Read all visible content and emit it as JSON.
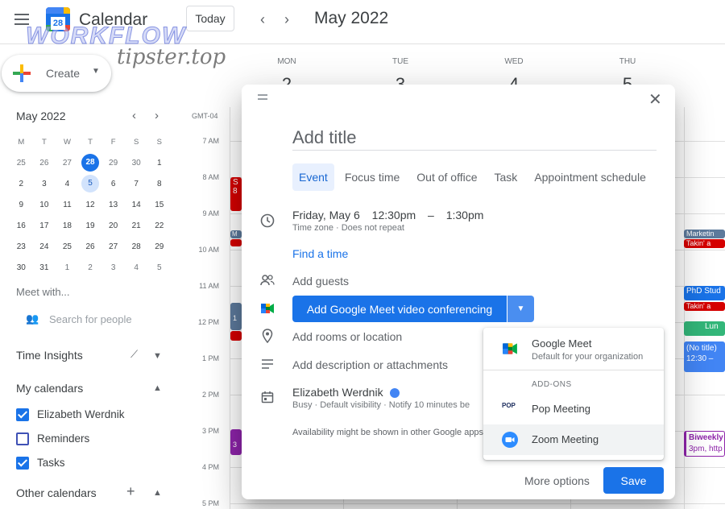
{
  "header": {
    "app_name": "Calendar",
    "logo_day": "28",
    "today_label": "Today",
    "month_title": "May 2022",
    "watermark_top": "WORKFLOW",
    "watermark_bottom": "tipster.top"
  },
  "create": {
    "label": "Create"
  },
  "mini_calendar": {
    "title": "May 2022",
    "weekdays": [
      "M",
      "T",
      "W",
      "T",
      "F",
      "S",
      "S"
    ],
    "weeks": [
      [
        "25",
        "26",
        "27",
        "28",
        "29",
        "30",
        "1"
      ],
      [
        "2",
        "3",
        "4",
        "5",
        "6",
        "7",
        "8"
      ],
      [
        "9",
        "10",
        "11",
        "12",
        "13",
        "14",
        "15"
      ],
      [
        "16",
        "17",
        "18",
        "19",
        "20",
        "21",
        "22"
      ],
      [
        "23",
        "24",
        "25",
        "26",
        "27",
        "28",
        "29"
      ],
      [
        "30",
        "31",
        "1",
        "2",
        "3",
        "4",
        "5"
      ]
    ]
  },
  "sidebar": {
    "meet_with": "Meet with...",
    "search_placeholder": "Search for people",
    "time_insights": "Time Insights",
    "my_calendars": "My calendars",
    "calendars": [
      {
        "name": "Elizabeth Werdnik",
        "checked": true
      },
      {
        "name": "Reminders",
        "checked": false
      },
      {
        "name": "Tasks",
        "checked": true
      }
    ],
    "other_calendars": "Other calendars"
  },
  "week": {
    "days": [
      {
        "dow": "MON",
        "num": "2"
      },
      {
        "dow": "TUE",
        "num": "3"
      },
      {
        "dow": "WED",
        "num": "4"
      },
      {
        "dow": "THU",
        "num": "5"
      }
    ],
    "timezone": "GMT-04",
    "hours": [
      "7 AM",
      "8 AM",
      "9 AM",
      "10 AM",
      "11 AM",
      "12 PM",
      "1 PM",
      "2 PM",
      "3 PM",
      "4 PM",
      "5 PM"
    ],
    "right_events": {
      "marketing": "Marketin",
      "takin1": "Takin' a",
      "phd": "PhD Stud",
      "takin2": "Takin' a",
      "lunch": "Lun",
      "notitle": "(No title)",
      "notitle_time": "12:30 –",
      "biweekly": "Biweekly",
      "biweekly_time": "3pm, http"
    },
    "left_events": {
      "ev1": "S\n8",
      "ev2": "M",
      "ev3": "1",
      "ev4": "3"
    }
  },
  "dialog": {
    "title_placeholder": "Add title",
    "tabs": [
      "Event",
      "Focus time",
      "Out of office",
      "Task",
      "Appointment schedule"
    ],
    "date": "Friday, May 6",
    "start": "12:30pm",
    "dash": "–",
    "end": "1:30pm",
    "time_sub": "Time zone · Does not repeat",
    "find_time": "Find a time",
    "add_guests": "Add guests",
    "meet_button": "Add Google Meet video conferencing",
    "rooms": "Add rooms or location",
    "description": "Add description or attachments",
    "owner": "Elizabeth Werdnik",
    "owner_sub": "Busy · Default visibility · Notify 10 minutes be",
    "availability": "Availability might be shown in other Google apps",
    "more_options": "More options",
    "save": "Save"
  },
  "conference_menu": {
    "google_meet": "Google Meet",
    "google_meet_sub": "Default for your organization",
    "addons_label": "ADD-ONS",
    "pop_logo": "POP",
    "pop": "Pop Meeting",
    "zoom": "Zoom Meeting"
  },
  "colors": {
    "accent": "#1a73e8",
    "event_red": "#d50000",
    "event_purple": "#8e24aa",
    "event_green": "#33b679",
    "event_blue": "#4285f4",
    "event_steel": "#5d7a9c"
  }
}
